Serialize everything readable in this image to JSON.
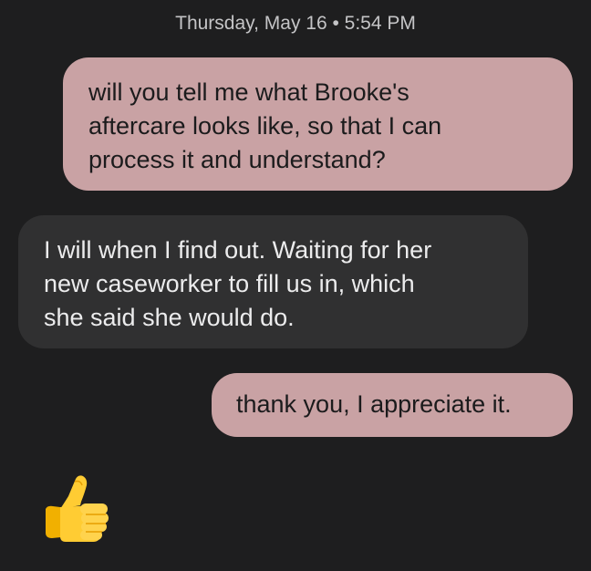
{
  "conversation": {
    "date_header": "Thursday, May 16 • 5:54 PM",
    "messages": [
      {
        "direction": "outgoing",
        "text": "will you tell me what Brooke's\naftercare looks like, so that I can\nprocess it and understand?"
      },
      {
        "direction": "incoming",
        "text": "I will when I find out. Waiting for her\nnew caseworker to fill us in, which\nshe said she would do."
      },
      {
        "direction": "outgoing",
        "text": "thank you, I appreciate it."
      }
    ],
    "reaction": {
      "icon": "thumbs-up-icon"
    }
  },
  "colors": {
    "background": "#1e1e1f",
    "outgoing_bubble": "#c9a2a4",
    "incoming_bubble": "#303031",
    "date_text": "#c4c4c6"
  }
}
